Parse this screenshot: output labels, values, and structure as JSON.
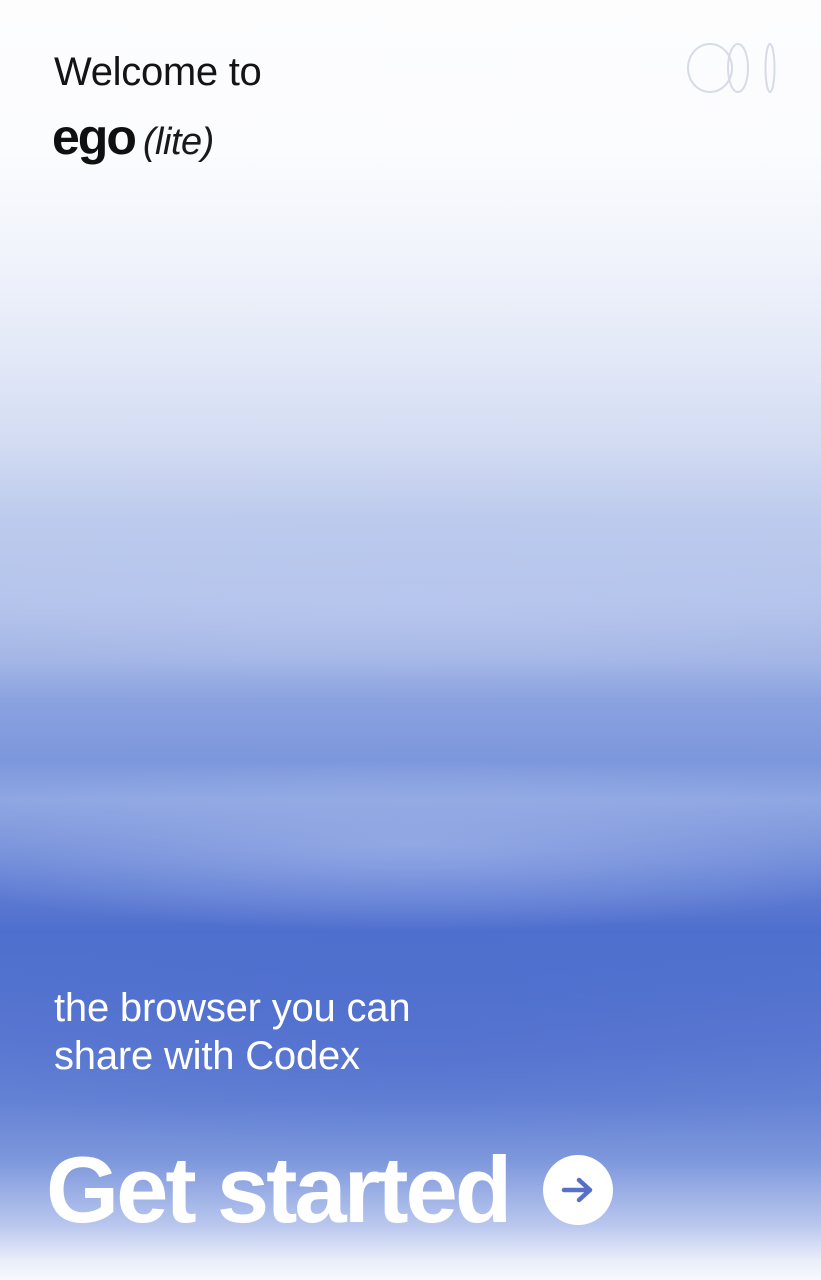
{
  "welcome": {
    "text": "Welcome to"
  },
  "brand": {
    "name": "ego",
    "variant": "(lite)"
  },
  "tagline": {
    "line1": "the browser you can",
    "line2": "share with Codex"
  },
  "cta": {
    "label": "Get started",
    "icon": "arrow-right-icon"
  },
  "icons": {
    "logo": "overlapping-rings-icon"
  },
  "colors": {
    "primary_blue": "#4f6fce",
    "text_dark": "#141414",
    "text_light": "#ffffff"
  }
}
